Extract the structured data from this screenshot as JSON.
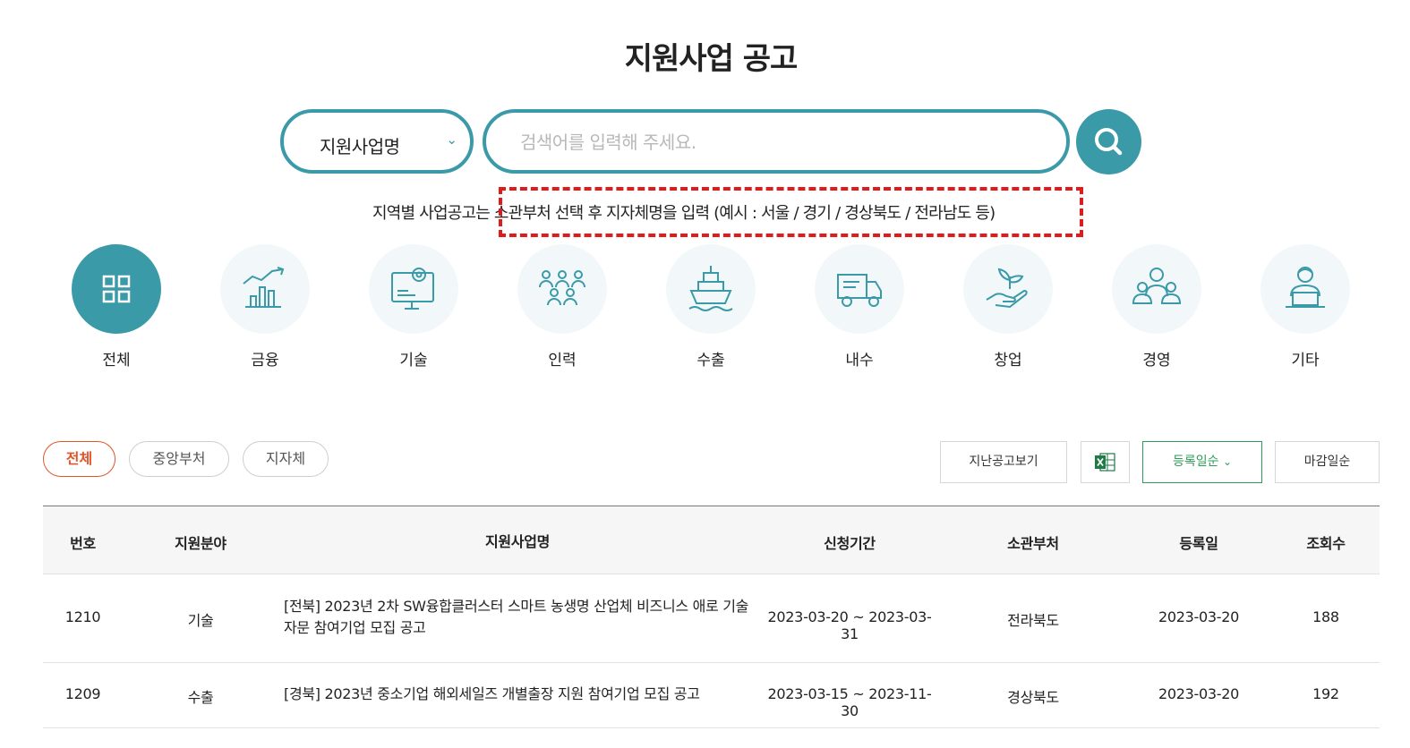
{
  "page": {
    "title": "지원사업 공고"
  },
  "search": {
    "select_value": "지원사업명",
    "placeholder": "검색어를 입력해 주세요."
  },
  "notice": {
    "text": "지역별 사업공고는 소관부처 선택 후 지자체명을 입력 (예시 : 서울 / 경기 / 경상북도 / 전라남도 등)"
  },
  "categories": [
    {
      "label": "전체",
      "icon": "grid-icon",
      "active": true
    },
    {
      "label": "금융",
      "icon": "finance-chart-icon"
    },
    {
      "label": "기술",
      "icon": "tech-monitor-gear-icon"
    },
    {
      "label": "인력",
      "icon": "people-group-icon"
    },
    {
      "label": "수출",
      "icon": "ship-icon"
    },
    {
      "label": "내수",
      "icon": "delivery-truck-icon"
    },
    {
      "label": "창업",
      "icon": "hand-sprout-icon"
    },
    {
      "label": "경영",
      "icon": "business-team-icon"
    },
    {
      "label": "기타",
      "icon": "person-laptop-icon"
    }
  ],
  "filters": {
    "chips": [
      "전체",
      "중앙부처",
      "지자체"
    ],
    "past_notices": "지난공고보기",
    "excel_icon": "excel-icon",
    "sort_registered": "등록일순",
    "sort_deadline": "마감일순"
  },
  "colors": {
    "accent": "#3a9aa8",
    "chip_active": "#e0562b",
    "sort_active": "#2e9c58",
    "notice_highlight": "#e01b1b"
  },
  "table": {
    "headers": [
      "번호",
      "지원분야",
      "지원사업명",
      "신청기간",
      "소관부처",
      "등록일",
      "조회수"
    ],
    "rows": [
      {
        "no": "1210",
        "field": "기술",
        "title": "[전북] 2023년 2차 SW융합클러스터 스마트 농생명 산업체 비즈니스 애로 기술자문 참여기업 모집 공고",
        "period": "2023-03-20 ~ 2023-03-31",
        "dept": "전라북도",
        "date": "2023-03-20",
        "views": "188"
      },
      {
        "no": "1209",
        "field": "수출",
        "title": "[경북] 2023년 중소기업 해외세일즈 개별출장 지원 참여기업 모집 공고",
        "period": "2023-03-15 ~ 2023-11-30",
        "dept": "경상북도",
        "date": "2023-03-20",
        "views": "192"
      }
    ]
  }
}
